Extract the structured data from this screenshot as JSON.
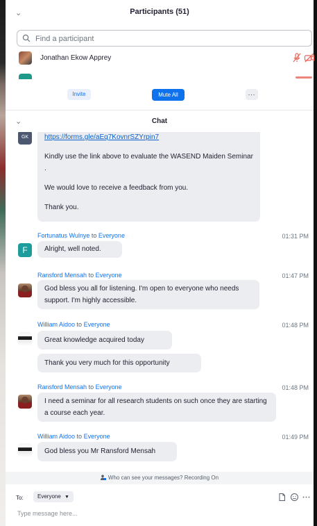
{
  "participants": {
    "title": "Participants (51)",
    "search_placeholder": "Find a participant",
    "rows": [
      {
        "name": "Jonathan Ekow Apprey"
      }
    ],
    "invite_label": "Invite",
    "mute_all_label": "Mute All",
    "more_label": "..."
  },
  "chat": {
    "title": "Chat",
    "top_message": {
      "avatar_initials": "GK",
      "link": "https://forms.gle/aEq7KovnrSZYrpin7",
      "lines": [
        "Kindly use the link above to evaluate the WASEND Maiden Seminar .",
        "We would love to receive a feedback from you.",
        "Thank you."
      ]
    },
    "messages": [
      {
        "sender": "Fortunatus Wulnye",
        "to": "to",
        "recipient": "Everyone",
        "time": "01:31 PM",
        "avatar_initial": "F",
        "bubbles": [
          "Alright, well noted."
        ]
      },
      {
        "sender": "Ransford Mensah",
        "to": "to",
        "recipient": "Everyone",
        "time": "01:47 PM",
        "bubbles": [
          "God bless you all for listening. I'm open to everyone who needs support. I'm highly accessible."
        ]
      },
      {
        "sender": "William Aidoo",
        "to": "to",
        "recipient": "Everyone",
        "time": "01:48 PM",
        "bubbles": [
          "Great knowledge acquired today",
          "Thank you very much for this opportunity"
        ]
      },
      {
        "sender": "Ransford Mensah",
        "to": "to",
        "recipient": "Everyone",
        "time": "01:48 PM",
        "bubbles": [
          "I need a seminar for all research students on such once they are starting a course each year."
        ]
      },
      {
        "sender": "William Aidoo",
        "to": "to",
        "recipient": "Everyone",
        "time": "01:49 PM",
        "bubbles": [
          "God bless you Mr Ransford Mensah"
        ]
      }
    ],
    "notice": "Who can see your messages? Recording On",
    "to_label": "To:",
    "to_value": "Everyone",
    "input_placeholder": "Type message here..."
  },
  "colors": {
    "accent": "#0e72ed",
    "bubble": "#ebedf0",
    "muted_red": "#e8665a"
  },
  "icons": [
    "chevron-down-icon",
    "search-icon",
    "mic-muted-icon",
    "video-off-icon",
    "lock-person-icon",
    "file-icon",
    "emoji-icon",
    "more-icon"
  ]
}
